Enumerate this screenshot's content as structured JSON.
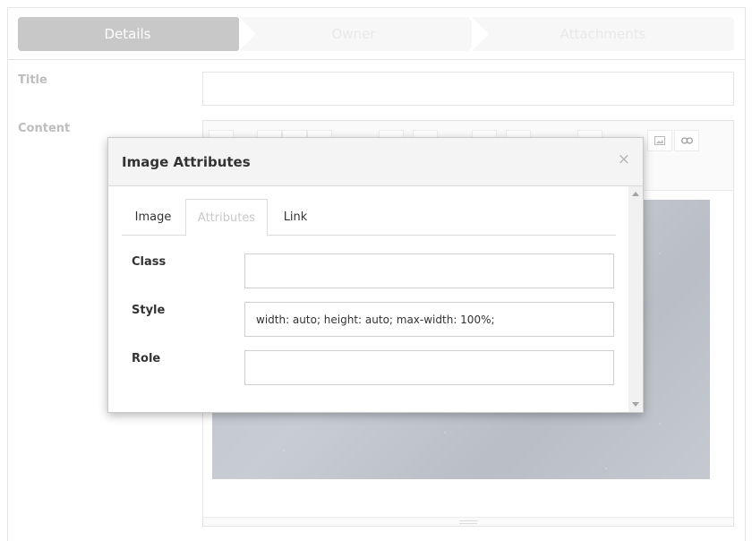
{
  "wizard": {
    "steps": [
      {
        "label": "Details"
      },
      {
        "label": "Owner"
      },
      {
        "label": "Attachments"
      }
    ]
  },
  "form": {
    "title_label": "Title",
    "content_label": "Content"
  },
  "modal": {
    "title": "Image Attributes",
    "close_symbol": "×",
    "tabs": [
      {
        "label": "Image"
      },
      {
        "label": "Attributes"
      },
      {
        "label": "Link"
      }
    ],
    "fields": {
      "class": {
        "label": "Class",
        "value": ""
      },
      "style": {
        "label": "Style",
        "value": "width: auto; height: auto; max-width: 100%;"
      },
      "role": {
        "label": "Role",
        "value": ""
      }
    }
  },
  "colors": {
    "active_step": "#c8c8c8",
    "inactive_step": "#f7f7f7",
    "label_muted": "#bdbdbd"
  },
  "icons": {
    "toolbar_visible": [
      "image-icon",
      "link-icon"
    ]
  }
}
